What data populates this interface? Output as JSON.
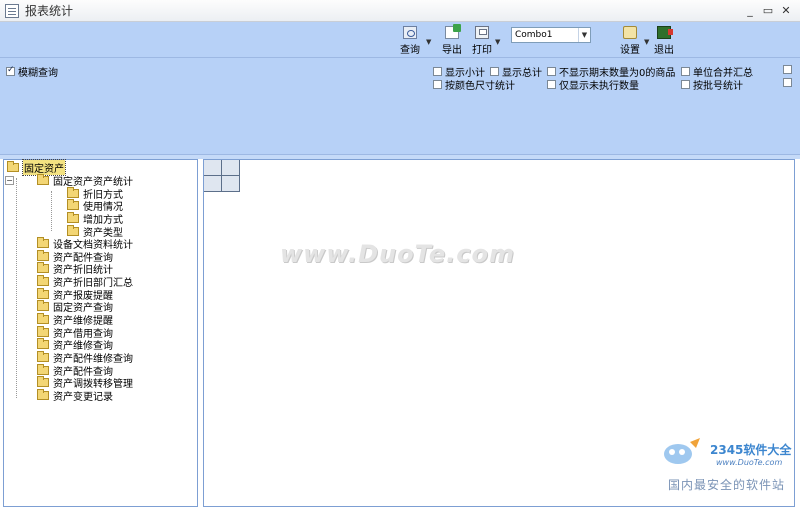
{
  "window": {
    "title": "报表统计",
    "controls": {
      "minimize": "_",
      "restore": "▭",
      "close": "✕"
    }
  },
  "toolbar": {
    "query": "查询",
    "export": "导出",
    "print": "打印",
    "combo_value": "Combo1",
    "settings": "设置",
    "exit": "退出"
  },
  "options": {
    "fuzzy_query": {
      "label": "模糊查询",
      "checked": true
    },
    "show_subtotal": {
      "label": "显示小计",
      "checked": false
    },
    "show_total": {
      "label": "显示总计",
      "checked": false
    },
    "hide_zero_end_qty": {
      "label": "不显示期末数量为0的商品",
      "checked": false
    },
    "merge_by_unit": {
      "label": "单位合并汇总",
      "checked": false
    },
    "by_color_size": {
      "label": "按颜色尺寸统计",
      "checked": false
    },
    "only_unexecuted": {
      "label": "仅显示未执行数量",
      "checked": false
    },
    "by_batch": {
      "label": "按批号统计",
      "checked": false
    }
  },
  "tree": {
    "root": "固定资产",
    "group": "固定资产资产统计",
    "group_children": [
      "折旧方式",
      "使用情况",
      "增加方式",
      "资产类型"
    ],
    "items": [
      "设备文档资料统计",
      "资产配件查询",
      "资产折旧统计",
      "资产折旧部门汇总",
      "资产报废提醒",
      "固定资产查询",
      "资产维修提醒",
      "资产借用查询",
      "资产维修查询",
      "资产配件维修查询",
      "资产配件查询",
      "资产调拨转移管理",
      "资产变更记录"
    ]
  },
  "watermarks": {
    "center": "www.DuoTe.com",
    "brand": "2345软件大全",
    "url": "www.DuoTe.com",
    "tagline": "国内最安全的软件站"
  },
  "colors": {
    "panel_blue": "#b7d1f7",
    "border_blue": "#7d9fd3",
    "selection_yellow": "#f3e281",
    "folder_yellow": "#f3d675"
  }
}
